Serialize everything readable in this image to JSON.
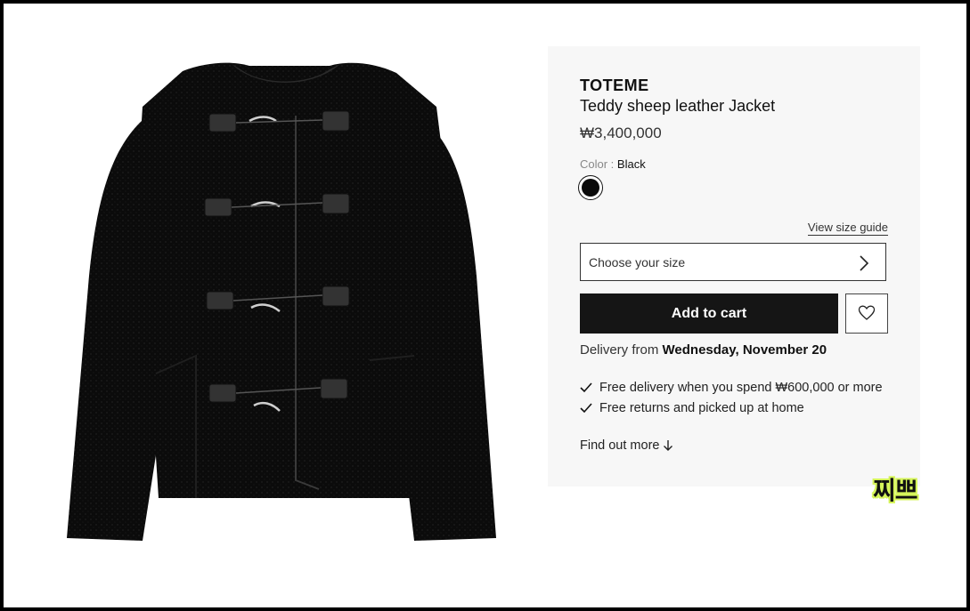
{
  "product": {
    "brand": "TOTEME",
    "name": "Teddy sheep leather Jacket",
    "price": "₩3,400,000",
    "color_label": "Color :",
    "color_value": "Black",
    "swatch_color": "#0a0a0a"
  },
  "size": {
    "guide_label": "View size guide",
    "placeholder": "Choose your size"
  },
  "actions": {
    "add_to_cart": "Add to cart"
  },
  "delivery": {
    "prefix": "Delivery from",
    "date": "Wednesday, November 20"
  },
  "benefits": [
    "Free delivery when you spend ₩600,000 or more",
    "Free returns and picked up at home"
  ],
  "links": {
    "find_out_more": "Find out more"
  },
  "watermark": "찌쁘",
  "icons": {
    "size_chevron": "chevron-right-icon",
    "wishlist": "heart-icon",
    "check": "check-icon",
    "arrow": "arrow-down-icon"
  }
}
